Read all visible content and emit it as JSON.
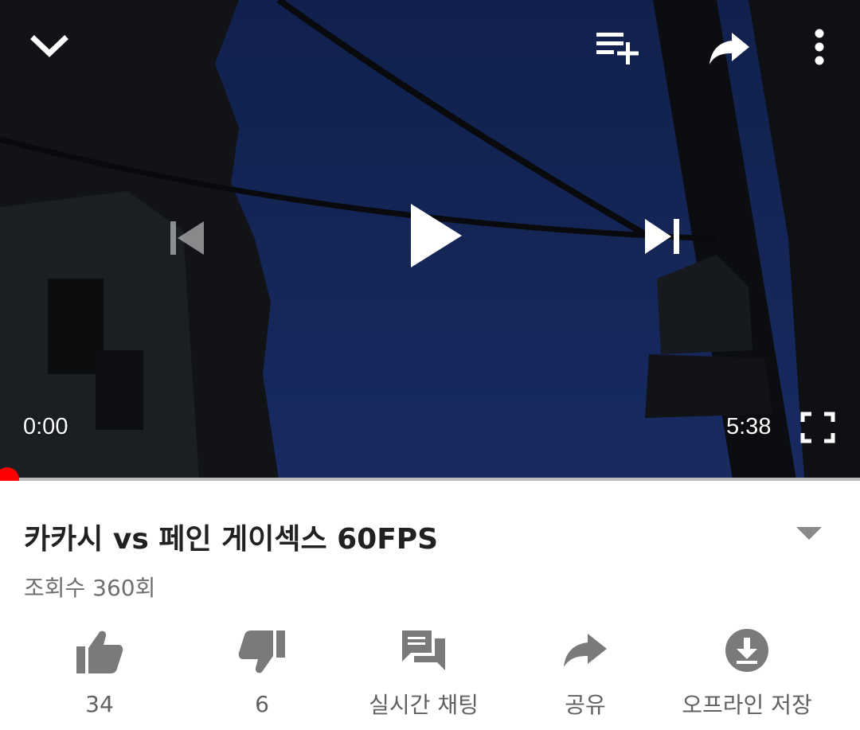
{
  "player": {
    "current_time": "0:00",
    "duration": "5:38",
    "progress_fraction": 0.0,
    "accent_color": "#ff0000"
  },
  "video": {
    "title": "카카시 vs 페인 게이섹스 60FPS",
    "views": "조회수 360회"
  },
  "actions": [
    {
      "icon": "thumbs-up-icon",
      "label": "34"
    },
    {
      "icon": "thumbs-down-icon",
      "label": "6"
    },
    {
      "icon": "chat-icon",
      "label": "실시간 채팅"
    },
    {
      "icon": "share-icon",
      "label": "공유"
    },
    {
      "icon": "download-icon",
      "label": "오프라인 저장"
    }
  ]
}
